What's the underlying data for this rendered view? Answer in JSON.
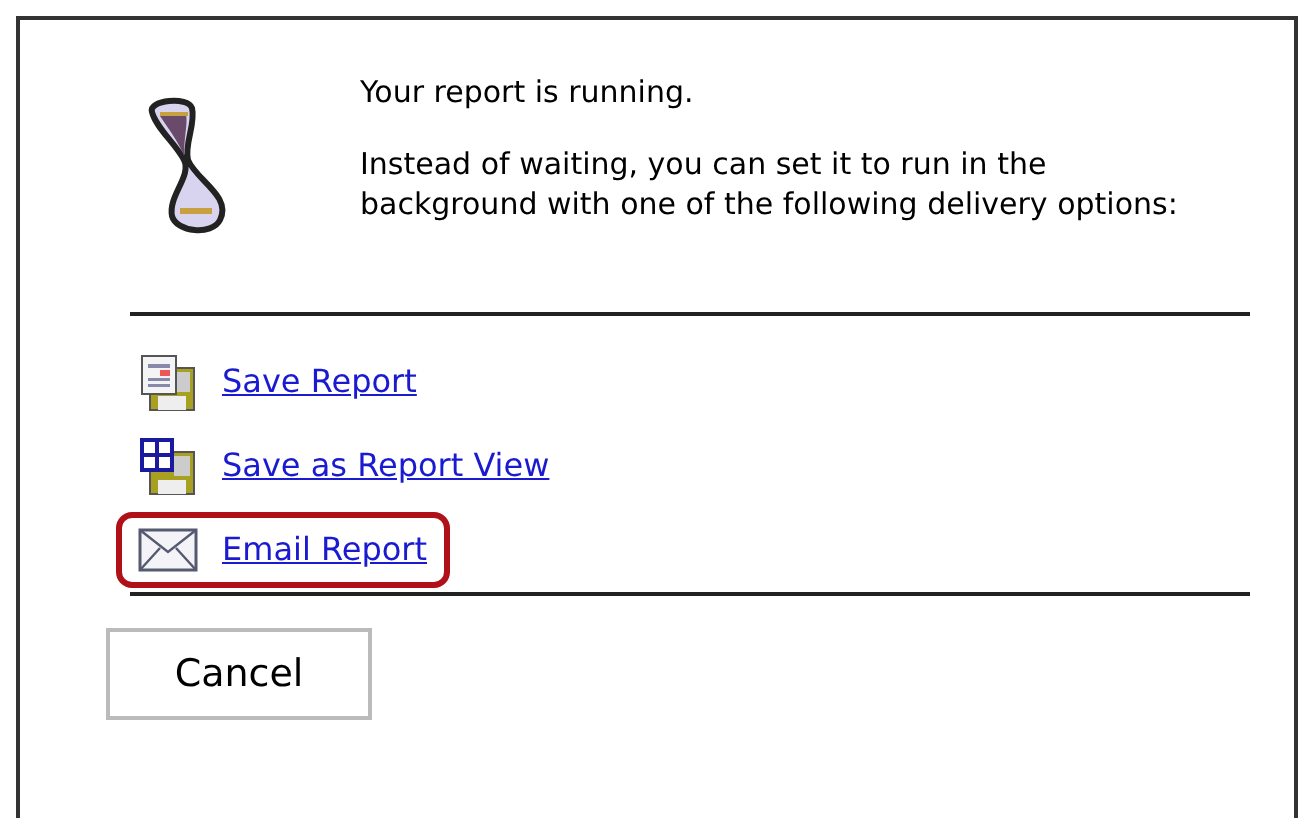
{
  "message": {
    "title": "Your report is running.",
    "body": "Instead of waiting, you can set it to run in the background with one of the following delivery options:"
  },
  "options": [
    {
      "label": "Save Report",
      "kind": "report",
      "highlighted": false
    },
    {
      "label": "Save as Report View",
      "kind": "view",
      "highlighted": false
    },
    {
      "label": "Email Report",
      "kind": "email",
      "highlighted": true
    }
  ],
  "buttons": [
    "Cancel"
  ]
}
